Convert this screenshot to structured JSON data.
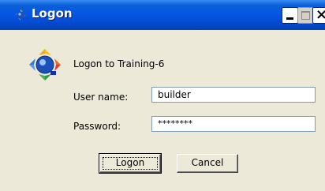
{
  "window": {
    "title": "Logon",
    "title_icon": "app-logo-icon",
    "controls": {
      "minimize": "minimize-icon",
      "maximize": "maximize-icon",
      "close": "×"
    }
  },
  "dialog": {
    "heading": "Logon to Training-6",
    "logo_icon": "app-logo-icon",
    "fields": {
      "user": {
        "label": "User name:",
        "value": "builder"
      },
      "password": {
        "label": "Password:",
        "value": "********"
      }
    },
    "buttons": {
      "logon": "Logon",
      "cancel": "Cancel"
    }
  },
  "colors": {
    "titlebar": "#0456e2",
    "dialog_bg": "#ece9d8",
    "field_border": "#7f9db9"
  }
}
